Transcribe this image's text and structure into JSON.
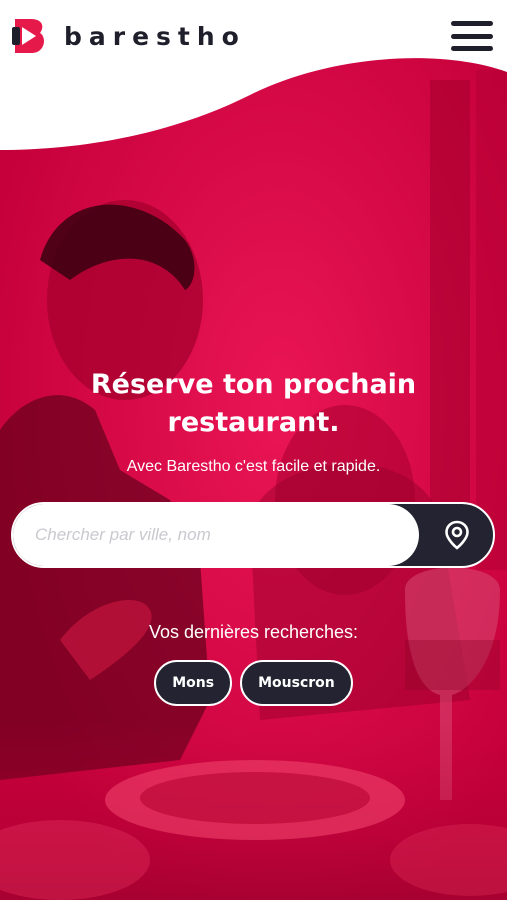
{
  "brand": {
    "name": "barestho",
    "accent": "#d6003f",
    "dark": "#232331"
  },
  "header": {
    "logo_icon": "barestho-play-logo",
    "menu_icon": "hamburger-menu-icon"
  },
  "hero": {
    "headline_line1": "Réserve ton prochain",
    "headline_line2": "restaurant.",
    "subline": "Avec Barestho c'est facile et rapide."
  },
  "search": {
    "placeholder": "Chercher par ville, nom",
    "value": "",
    "button_icon": "location-pin-icon"
  },
  "recent": {
    "title": "Vos dernières recherches:",
    "items": [
      {
        "label": "Mons"
      },
      {
        "label": "Mouscron"
      }
    ]
  }
}
